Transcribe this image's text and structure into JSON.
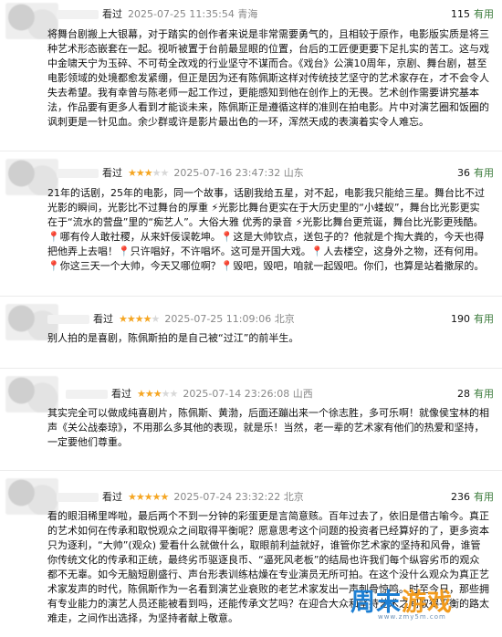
{
  "reviews": [
    {
      "watched": "看过",
      "rating": 0,
      "date": "2025-07-25 11:35:54",
      "location": "青海",
      "votes": "115",
      "useful": "有用",
      "text": "将舞台剧搬上大银幕，对于踏实的创作者来说是非常需要勇气的，且相较于原作，电影版实质是将三种艺术形态嵌套在一起。视听被置于台前最显眼的位置，台后的工匠便更要下足扎实的苦工。这与戏中金啸天宁为玉碎、不可苟全改戏的行业坚守不谋而合。《戏台》公演10周年，京剧、舞台剧，甚至电影领域的处境都愈发紧绷，但正是因为还有陈佩斯这样对传统技艺坚守的艺术家存在，才不会令人失去希望。我有幸曾与陈老师一起工作过，更能感知到他在创作上的无畏。艺术创作需要讲究基本法，作品要有更多人看到才能谈未来，陈佩斯正是遵循这样的准则在拍电影。片中对演艺圈和饭圈的讽刺更是一针见血。余少群或许是影片最出色的一环，浑然天成的表演着实令人难忘。"
    },
    {
      "watched": "看过",
      "rating": 3,
      "date": "2025-07-16 23:47:32",
      "location": "山东",
      "votes": "36",
      "useful": "有用",
      "text": "21年的话剧，25年的电影，同一个故事，话剧我给五星，对不起，电影我只能给三星。舞台比不过光影的瞬间，光影比不过舞台的厚重 ⚡光影比舞台更实在于大历史里的“小蝼蚁”，舞台比光影更实在于“流水的营盘”里的“痴艺人”。大俗大雅 优秀的录音 ⚡光影比舞台更荒诞，舞台比光影更残酷。📍哪有伶人敢社稷，从来奸佞误乾坤。📍这是大帅钦点，送包子的？他就是个掏大粪的，今天也得把他弄上去唱！📍只许唱好，不许唱坏。这可是开国大戏。📍人去楼空，这身外之物，还有何用。📍你这三天一个大帅，今天又哪位啊？📍毁吧，毁吧，咱就一起毁吧。你们，也算是站着撒尿的。"
    },
    {
      "watched": "看过",
      "rating": 4,
      "date": "2025-07-25 11:09:06",
      "location": "北京",
      "votes": "190",
      "useful": "有用",
      "text": "别人拍的是喜剧，陈佩斯拍的是自己被“过江”的前半生。"
    },
    {
      "watched": "看过",
      "rating": 3,
      "date": "2025-07-14 23:26:08",
      "location": "山西",
      "votes": "28",
      "useful": "有用",
      "text": "其实完全可以做成纯喜剧片，陈佩斯、黄渤，后面还蹦出来一个徐志胜，多可乐啊！就像侯宝林的相声《关公战秦琼》，不用那么多其他的表现，就是乐！当然，老一辈的艺术家有他们的热爱和坚持，一定要他们尊重。"
    },
    {
      "watched": "看过",
      "rating": 5,
      "date": "2025-07-24 23:32:22",
      "location": "北京",
      "votes": "236",
      "useful": "有用",
      "text": "看的眼泪稀里哗啦，最后两个不到一分钟的彩蛋更是言简意赅。百年过去了，依旧是借古喻今。真正的艺术如何在传承和取悦观众之间取得平衡呢？愿意思考这个问题的投资者已经算好的了，更多资本只为逐利，“大帅”(观众) 爱看什么就做什么，取眼前利益就好，谁管你艺术家的坚持和风骨，谁管你传统文化的传承和正统，最终劣币驱逐良币、“逼死风老板”的结局也许我们每个纵容劣币的观众都不无辜。如今无脑短剧盛行、声台形表训练枯燥在专业演员无所可拍。在这个没什么观众为真正艺术家发声的时代，陈佩斯作为一名看到演艺业衰败的老艺术家发出一声刺骨惊鸣。时至今日，那些拥有专业能力的演艺人员还能被看到吗，还能传承文艺吗？在迎合大众和坚持艺术之间取得平衡的路太难走，之间作出选择，为坚持者献上敬意。"
    }
  ],
  "watermark": {
    "brand_part1": "周末",
    "brand_part2": "游戏",
    "domain": "www.zmy5m.com"
  },
  "colors": {
    "star_on": "#f5a623",
    "star_off": "#d8d8d8",
    "useful": "#3a7a3a",
    "meta": "#888888"
  }
}
